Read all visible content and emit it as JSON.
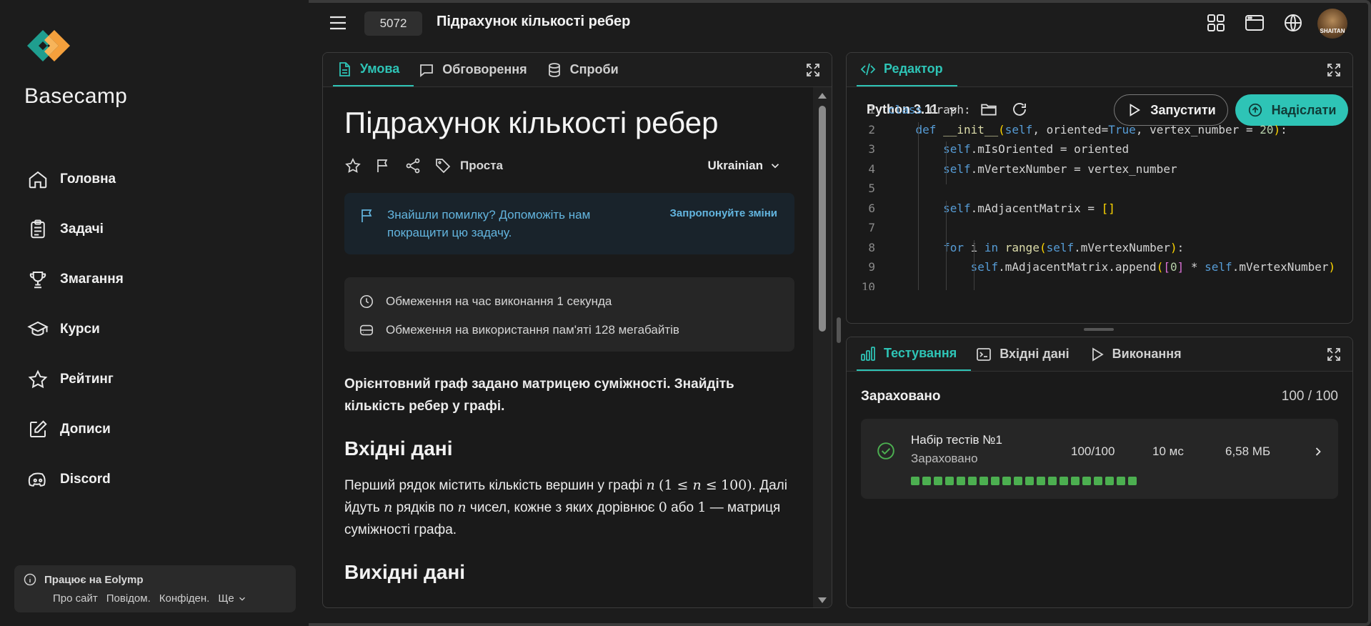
{
  "sidebar": {
    "brand": "Basecamp",
    "nav": [
      {
        "label": "Головна",
        "icon": "home-icon"
      },
      {
        "label": "Задачі",
        "icon": "tasks-icon"
      },
      {
        "label": "Змагання",
        "icon": "trophy-icon"
      },
      {
        "label": "Курси",
        "icon": "graduation-cap-icon"
      },
      {
        "label": "Рейтинг",
        "icon": "star-icon"
      },
      {
        "label": "Дописи",
        "icon": "edit-icon"
      },
      {
        "label": "Discord",
        "icon": "discord-icon"
      }
    ],
    "footer": {
      "title": "Працює на Eolymp",
      "links": [
        "Про сайт",
        "Повідом.",
        "Конфіден.",
        "Ще"
      ]
    }
  },
  "header": {
    "problem_id": "5072",
    "problem_title": "Підрахунок кількості ребер",
    "avatar_text": "SHAITAN"
  },
  "statement": {
    "tabs": [
      {
        "label": "Умова",
        "icon": "document-icon",
        "active": true
      },
      {
        "label": "Обговорення",
        "icon": "chat-icon",
        "active": false
      },
      {
        "label": "Спроби",
        "icon": "database-icon",
        "active": false
      }
    ],
    "title": "Підрахунок кількості ребер",
    "difficulty": "Проста",
    "language": "Ukrainian",
    "bug_notice": "Знайшли помилку? Допоможіть нам покращити цю задачу.",
    "bug_link": "Запропонуйте зміни",
    "limits": [
      "Обмеження на час виконання 1 секунда",
      "Обмеження на використання пам'яті 128 мегабайтів"
    ],
    "intro": "Орієнтовний граф задано матрицею суміжності. Знайдіть кількість ребер у графі.",
    "input_heading": "Вхідні дані",
    "input_text": {
      "p1": "Перший рядок містить кількість вершин у графі ",
      "n": "n",
      "ineq": "(1 ≤ ",
      "ineq2": " ≤",
      "hundred": "100)",
      "p2": ". Далі йдуть ",
      "p3": " рядків по ",
      "p4": " чисел, кожне з яких дорівнює ",
      "zero": "0",
      "p5": "або ",
      "one": "1",
      "p6": " — матриця суміжності графа."
    },
    "output_heading": "Вихідні дані"
  },
  "editor": {
    "tab_label": "Редактор",
    "language": "Python 3.11",
    "run_label": "Запустити",
    "submit_label": "Надіслати",
    "line_numbers": [
      "1",
      "2",
      "3",
      "4",
      "5",
      "6",
      "7",
      "8",
      "9",
      "10"
    ]
  },
  "testing": {
    "tabs": [
      {
        "label": "Тестування",
        "icon": "chart-icon",
        "active": true
      },
      {
        "label": "Вхідні дані",
        "icon": "terminal-icon",
        "active": false
      },
      {
        "label": "Виконання",
        "icon": "play-icon",
        "active": false
      }
    ],
    "status": "Зараховано",
    "score": "100 / 100",
    "suite": {
      "name": "Набір тестів №1",
      "status": "Зараховано",
      "score": "100/100",
      "time": "10 мс",
      "memory": "6,58 МБ",
      "passed_tests": 20
    }
  },
  "colors": {
    "accent": "#2ec4b6",
    "info": "#63b5df",
    "pass": "#4caf50"
  }
}
